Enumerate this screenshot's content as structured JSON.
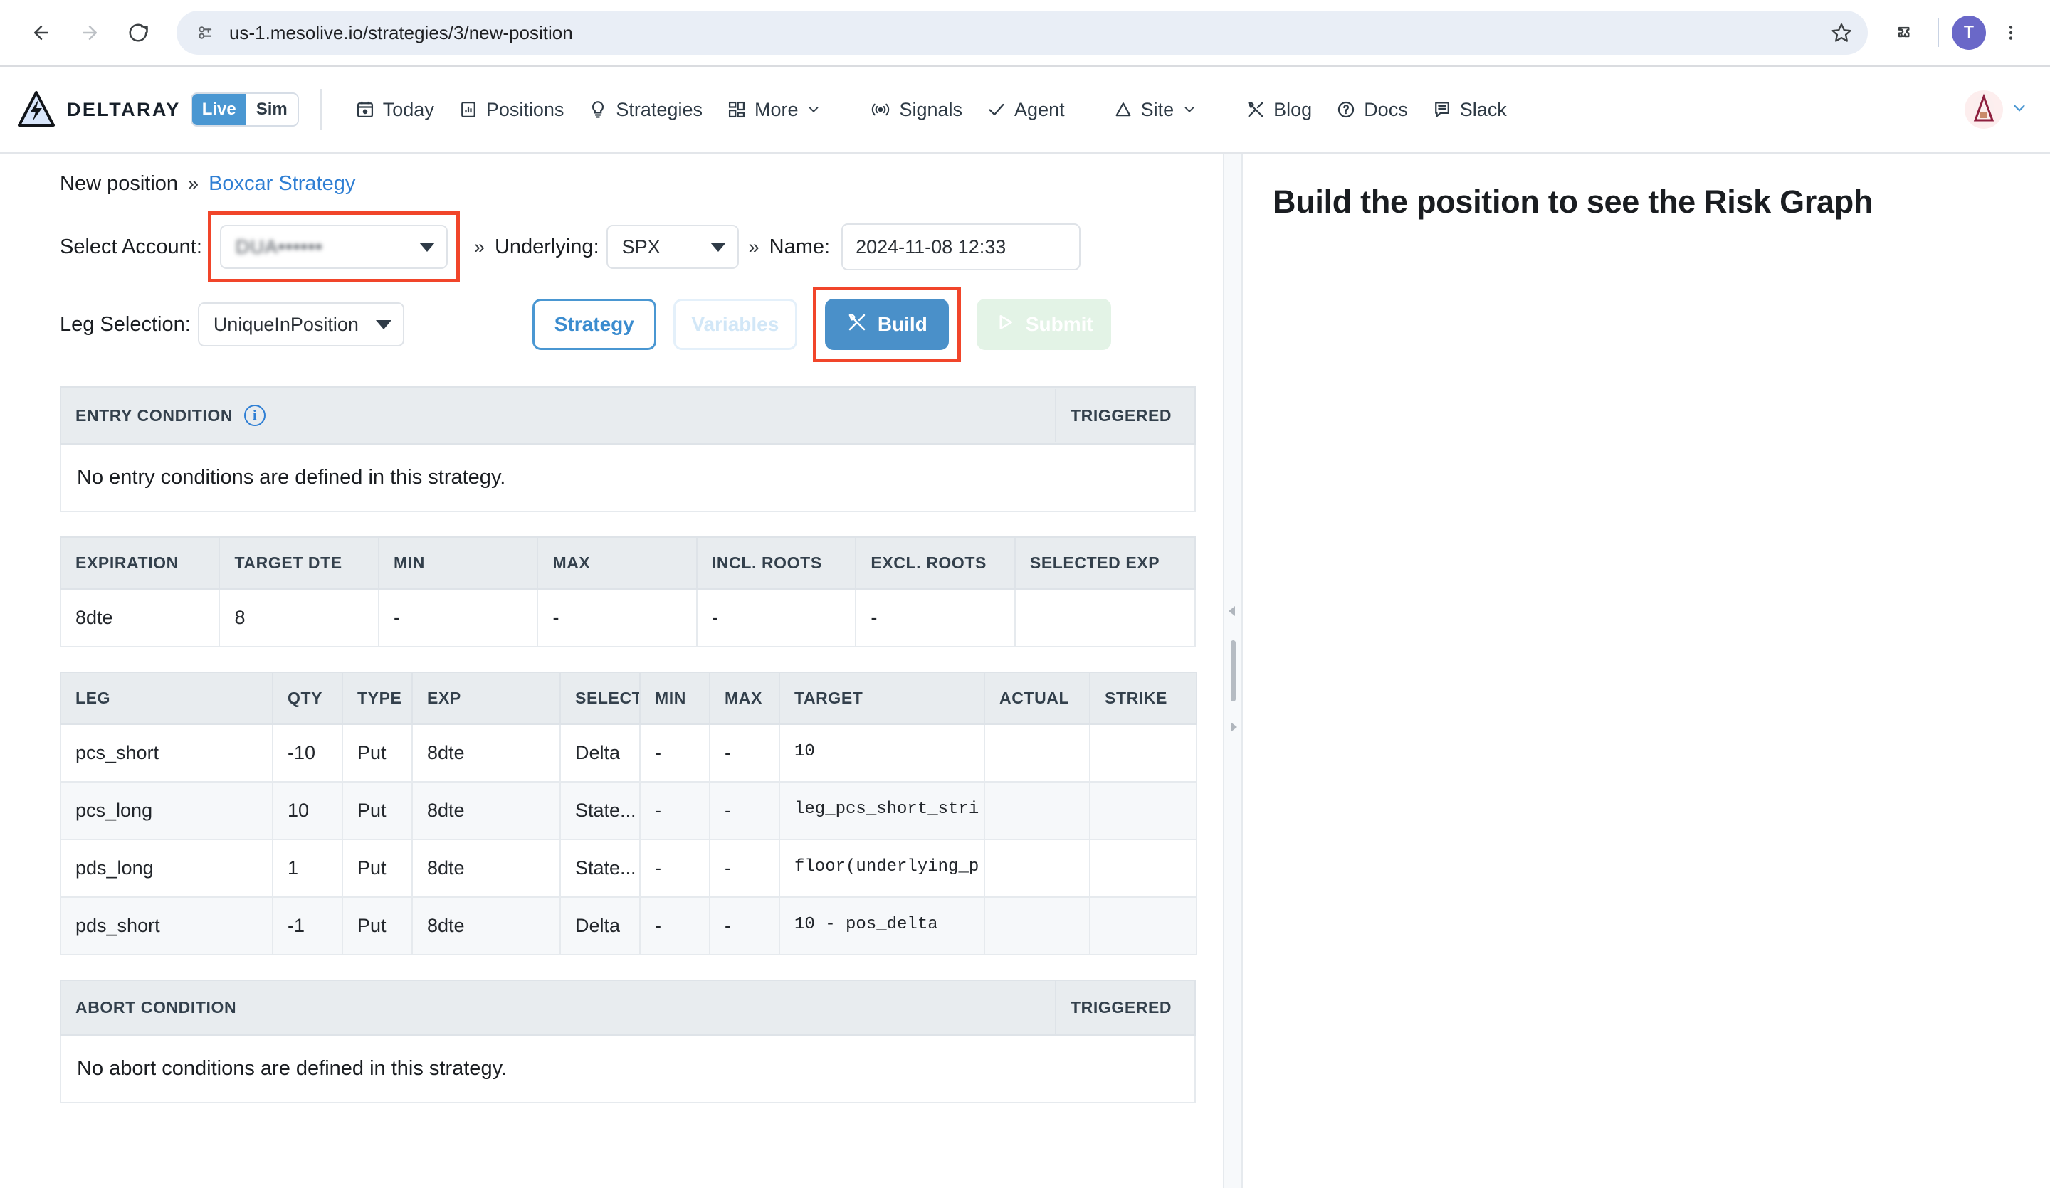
{
  "browser": {
    "url": "us-1.mesolive.io/strategies/3/new-position",
    "back_label": "Back",
    "forward_label": "Forward",
    "reload_label": "Reload",
    "site_info_label": "View site information",
    "bookmark_label": "Bookmark this tab",
    "extensions_label": "Extensions",
    "profile_initial": "T",
    "menu_label": "Customize and control Google Chrome"
  },
  "header": {
    "brand": "DELTARAY",
    "mode_toggle": {
      "live": "Live",
      "sim": "Sim",
      "active": "Live",
      "active_color": "#4a97d2"
    },
    "nav": [
      {
        "label": "Today",
        "icon": "calendar-icon",
        "caret": false
      },
      {
        "label": "Positions",
        "icon": "bar-chart-icon",
        "caret": false
      },
      {
        "label": "Strategies",
        "icon": "lightbulb-icon",
        "caret": false
      },
      {
        "label": "More",
        "icon": "grid-icon",
        "caret": true
      }
    ],
    "nav2": [
      {
        "label": "Signals",
        "icon": "broadcast-icon",
        "caret": false
      },
      {
        "label": "Agent",
        "icon": "check-icon",
        "caret": false
      }
    ],
    "nav3": [
      {
        "label": "Site",
        "icon": "triangle-icon",
        "caret": true
      }
    ],
    "nav4": [
      {
        "label": "Blog",
        "icon": "tools-icon",
        "caret": false
      },
      {
        "label": "Docs",
        "icon": "question-circle-icon",
        "caret": false
      },
      {
        "label": "Slack",
        "icon": "message-icon",
        "caret": false
      }
    ]
  },
  "breadcrumb": {
    "current": "New position",
    "separator": "»",
    "strategy_link": "Boxcar Strategy"
  },
  "form": {
    "account_label": "Select Account:",
    "account_value": "DUA••••••",
    "account_highlighted": true,
    "sep1": "»",
    "underlying_label": "Underlying:",
    "underlying_value": "SPX",
    "sep2": "»",
    "name_label": "Name:",
    "name_value": "2024-11-08 12:33",
    "leg_selection_label": "Leg Selection:",
    "leg_selection_value": "UniqueInPosition"
  },
  "buttons": {
    "strategy": "Strategy",
    "variables": "Variables",
    "build": "Build",
    "build_icon": "tools-icon",
    "build_highlighted": true,
    "submit": "Submit",
    "submit_icon": "play-icon",
    "submit_disabled": true,
    "variables_disabled": true
  },
  "entry_condition": {
    "title": "ENTRY CONDITION",
    "info_icon": "info-icon",
    "triggered_header": "TRIGGERED",
    "empty_message": "No entry conditions are defined in this strategy."
  },
  "expiration_table": {
    "columns": [
      "EXPIRATION",
      "TARGET DTE",
      "MIN",
      "MAX",
      "INCL. ROOTS",
      "EXCL. ROOTS",
      "SELECTED EXP"
    ],
    "rows": [
      [
        "8dte",
        "8",
        "-",
        "-",
        "-",
        "-",
        ""
      ]
    ]
  },
  "leg_table": {
    "columns": [
      "LEG",
      "QTY",
      "TYPE",
      "EXP",
      "SELECTOR",
      "MIN",
      "MAX",
      "TARGET",
      "ACTUAL",
      "STRIKE"
    ],
    "rows": [
      [
        "pcs_short",
        "-10",
        "Put",
        "8dte",
        "Delta",
        "-",
        "-",
        "10",
        "",
        ""
      ],
      [
        "pcs_long",
        "10",
        "Put",
        "8dte",
        "State...",
        "-",
        "-",
        "leg_pcs_short_stri",
        "",
        ""
      ],
      [
        "pds_long",
        "1",
        "Put",
        "8dte",
        "State...",
        "-",
        "-",
        "floor(underlying_p",
        "",
        ""
      ],
      [
        "pds_short",
        "-1",
        "Put",
        "8dte",
        "Delta",
        "-",
        "-",
        "10 - pos_delta",
        "",
        ""
      ]
    ]
  },
  "abort_condition": {
    "title": "ABORT CONDITION",
    "triggered_header": "TRIGGERED",
    "empty_message": "No abort conditions are defined in this strategy."
  },
  "right_panel": {
    "message": "Build the position to see the Risk Graph"
  },
  "splitter": {
    "collapse_left_label": "Collapse left",
    "expand_right_label": "Expand right"
  }
}
